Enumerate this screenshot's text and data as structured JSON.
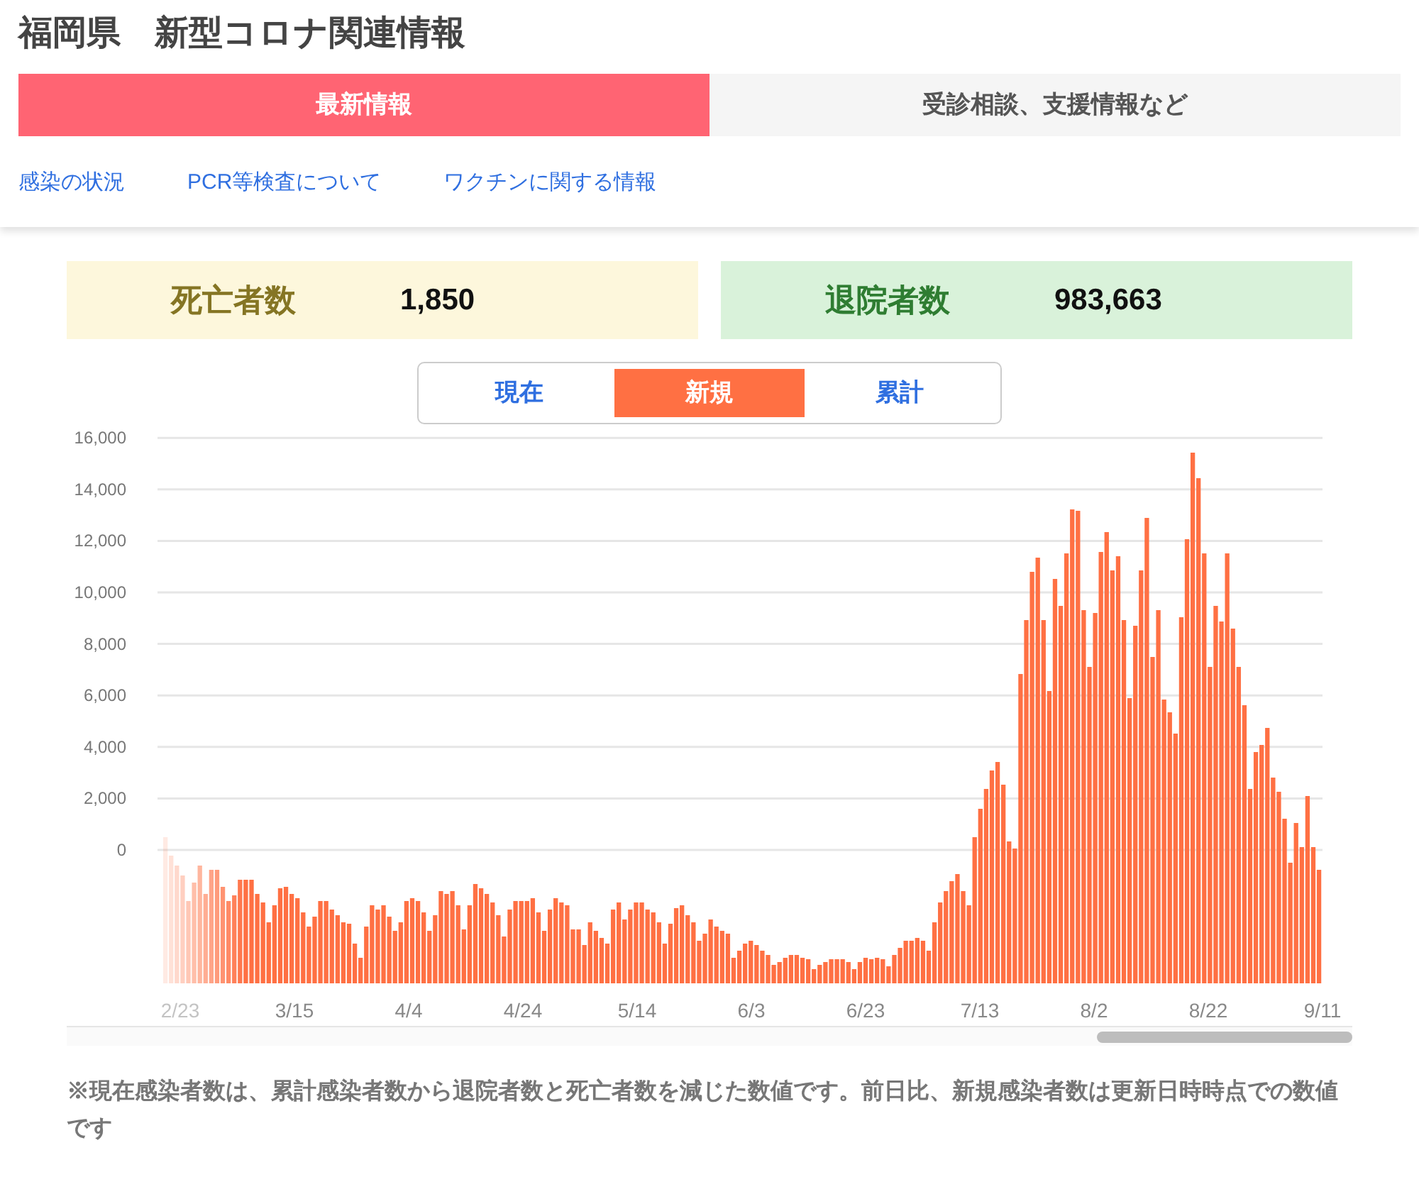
{
  "title": "福岡県　新型コロナ関連情報",
  "tabs": [
    {
      "label": "最新情報",
      "selected": true
    },
    {
      "label": "受診相談、支援情報など",
      "selected": false
    }
  ],
  "links": [
    "感染の状況",
    "PCR等検査について",
    "ワクチンに関する情報"
  ],
  "stats": [
    {
      "kind": "deaths",
      "label": "死亡者数",
      "value": "1,850"
    },
    {
      "kind": "discharged",
      "label": "退院者数",
      "value": "983,663"
    }
  ],
  "segments": [
    {
      "label": "現在",
      "selected": false
    },
    {
      "label": "新規",
      "selected": true
    },
    {
      "label": "累計",
      "selected": false
    }
  ],
  "chart": {
    "y_axis_labels": [
      "16,000",
      "14,000",
      "12,000",
      "10,000",
      "8,000",
      "6,000",
      "4,000",
      "2,000",
      "0"
    ],
    "x_axis_labels": [
      "2/23",
      "3/15",
      "4/4",
      "4/24",
      "5/14",
      "6/3",
      "6/23",
      "7/13",
      "8/2",
      "8/22",
      "9/11"
    ]
  },
  "note": "※現在感染者数は、累計感染者数から退院者数と死亡者数を減じた数値です。前日比、新規感染者数は更新日時時点での数値です"
}
